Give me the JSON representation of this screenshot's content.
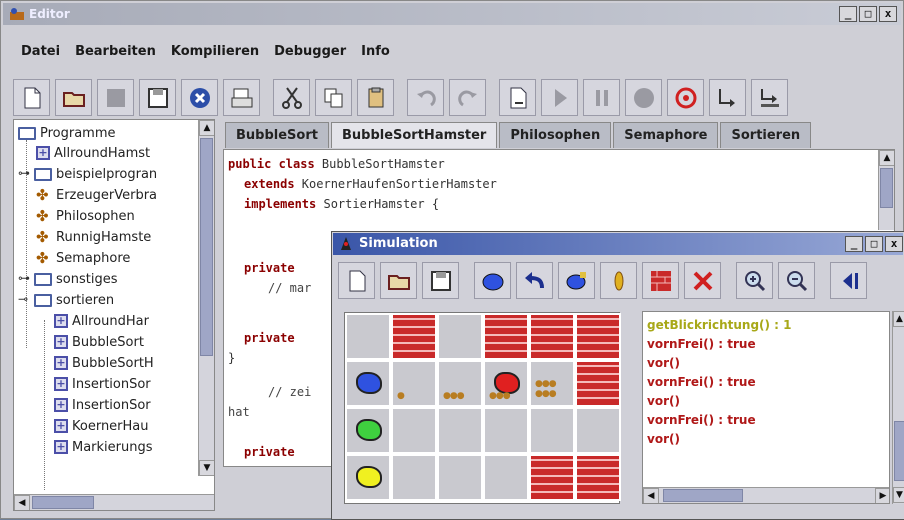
{
  "window": {
    "title": "Editor"
  },
  "window_buttons": [
    "_",
    "□",
    "x"
  ],
  "menu": [
    "Datei",
    "Bearbeiten",
    "Kompilieren",
    "Debugger",
    "Info"
  ],
  "toolbar": {
    "icons": [
      "new-file-icon",
      "open-folder-icon",
      "save-disabled-icon",
      "save-all-icon",
      "close-icon",
      "print-icon",
      "cut-icon",
      "copy-icon",
      "paste-icon",
      "undo-icon",
      "redo-icon",
      "compile-icon",
      "run-icon",
      "pause-icon",
      "stop-icon",
      "breakpoint-icon",
      "step-into-icon",
      "step-over-icon"
    ]
  },
  "tree": {
    "items": [
      {
        "label": "Programme",
        "type": "folder",
        "level": 0
      },
      {
        "label": "AllroundHamst",
        "type": "class",
        "level": 1
      },
      {
        "label": "beispielprogran",
        "type": "folder",
        "level": 0
      },
      {
        "label": "ErzeugerVerbra",
        "type": "run",
        "level": 1
      },
      {
        "label": "Philosophen",
        "type": "run",
        "level": 1
      },
      {
        "label": "RunnigHamste",
        "type": "run",
        "level": 1
      },
      {
        "label": "Semaphore",
        "type": "run",
        "level": 1
      },
      {
        "label": "sonstiges",
        "type": "folder",
        "level": 0
      },
      {
        "label": "sortieren",
        "type": "folder",
        "level": 0
      },
      {
        "label": "AllroundHar",
        "type": "class",
        "level": 2
      },
      {
        "label": "BubbleSort",
        "type": "class",
        "level": 2
      },
      {
        "label": "BubbleSortH",
        "type": "class",
        "level": 2
      },
      {
        "label": "InsertionSor",
        "type": "class",
        "level": 2
      },
      {
        "label": "InsertionSor",
        "type": "class",
        "level": 2
      },
      {
        "label": "KoernerHau",
        "type": "class",
        "level": 2
      },
      {
        "label": "Markierungs",
        "type": "class",
        "level": 2
      }
    ]
  },
  "tabs": [
    "BubbleSort",
    "BubbleSortHamster",
    "Philosophen",
    "Semaphore",
    "Sortieren"
  ],
  "active_tab": "BubbleSortHamster",
  "code": {
    "line1_kw": "public class ",
    "line1_rest": "BubbleSortHamster",
    "line2_kw": "extends ",
    "line2_rest": "KoernerHaufenSortierHamster",
    "line3_kw": "implements ",
    "line3_rest": "SortierHamster {",
    "line4_kw": "private",
    "line5": "// mar",
    "line6_kw": "private",
    "line7": "}",
    "line8": "// zei",
    "line9": "hat",
    "line10_kw": "private"
  },
  "simulation": {
    "title": "Simulation",
    "toolbar_icons": [
      "new-territory-icon",
      "open-icon",
      "save-icon",
      "blue-hamster-icon",
      "turn-left-icon",
      "hamster-set-icon",
      "grain-icon",
      "wall-icon",
      "delete-icon",
      "zoom-in-icon",
      "zoom-out-icon",
      "back-icon"
    ],
    "grid": [
      [
        "empty",
        "wall",
        "empty",
        "wall",
        "wall",
        "wall"
      ],
      [
        "hamster-blue",
        "grain1",
        "grain3",
        "hamster-red",
        "grain6",
        "wall"
      ],
      [
        "hamster-green",
        "empty",
        "empty",
        "empty",
        "empty",
        "empty"
      ],
      [
        "hamster-yellow",
        "empty",
        "empty",
        "empty",
        "wall",
        "wall"
      ]
    ],
    "log": [
      {
        "text": "getBlickrichtung() : 1",
        "color": "#a8a818"
      },
      {
        "text": "vornFrei() : true",
        "color": "#b01818"
      },
      {
        "text": "vor()",
        "color": "#b01818"
      },
      {
        "text": "vornFrei() : true",
        "color": "#b01818"
      },
      {
        "text": "vor()",
        "color": "#b01818"
      },
      {
        "text": "vornFrei() : true",
        "color": "#b01818"
      },
      {
        "text": "vor()",
        "color": "#b01818"
      }
    ]
  },
  "colors": {
    "keyword": "#8b0000",
    "wall": "#c92a2a",
    "hamster_blue": "#2f52e0",
    "hamster_red": "#e02020",
    "hamster_green": "#3fd03f",
    "hamster_yellow": "#f0f020"
  }
}
